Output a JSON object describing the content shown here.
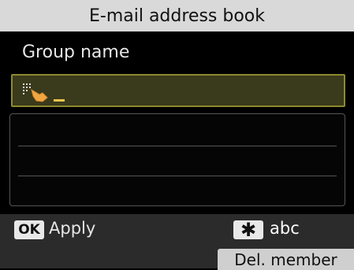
{
  "header": {
    "title": "E-mail address book"
  },
  "form": {
    "field_label": "Group name",
    "input_value": ""
  },
  "footer": {
    "ok_key": "OK",
    "apply_label": "Apply",
    "star_key": "✱",
    "mode_label": "abc",
    "del_member_label": "Del. member"
  },
  "colors": {
    "input_border": "#8c8a2e",
    "cursor": "#e8c44a"
  }
}
